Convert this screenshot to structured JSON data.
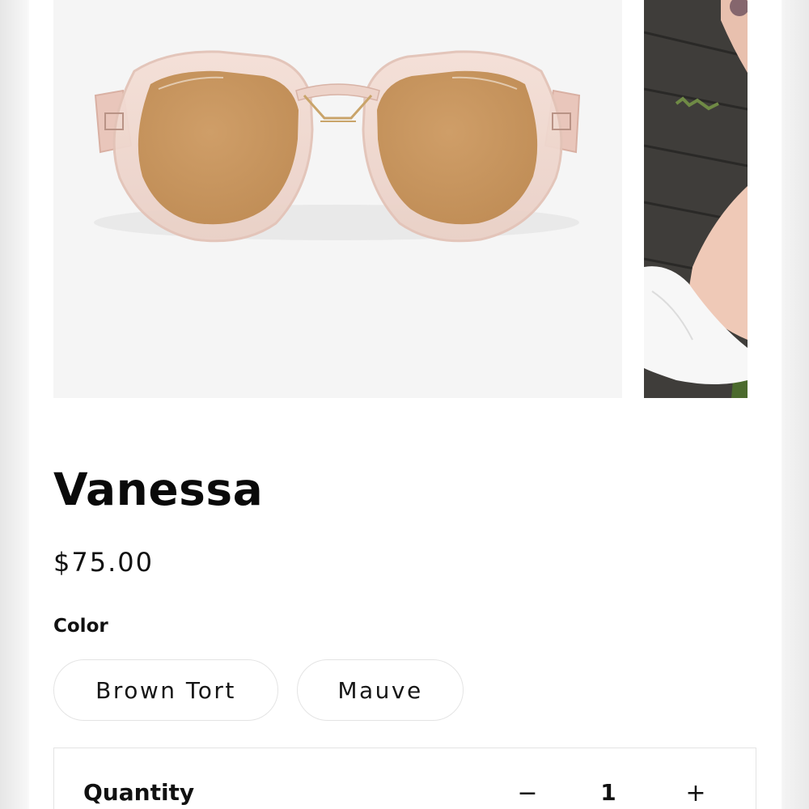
{
  "product": {
    "title": "Vanessa",
    "price": "$75.00"
  },
  "gallery": {
    "main_image": "sunglasses-product-photo",
    "side_image": "model-wearing-sunglasses-photo"
  },
  "color": {
    "label": "Color",
    "options": [
      "Brown Tort",
      "Mauve"
    ]
  },
  "quantity": {
    "label": "Quantity",
    "decrement_symbol": "−",
    "value": "1",
    "increment_symbol": "+"
  },
  "colors": {
    "lens": "#c8965e",
    "frame": "#f0d6cc",
    "border": "#e4e4e4",
    "text": "#111111"
  }
}
